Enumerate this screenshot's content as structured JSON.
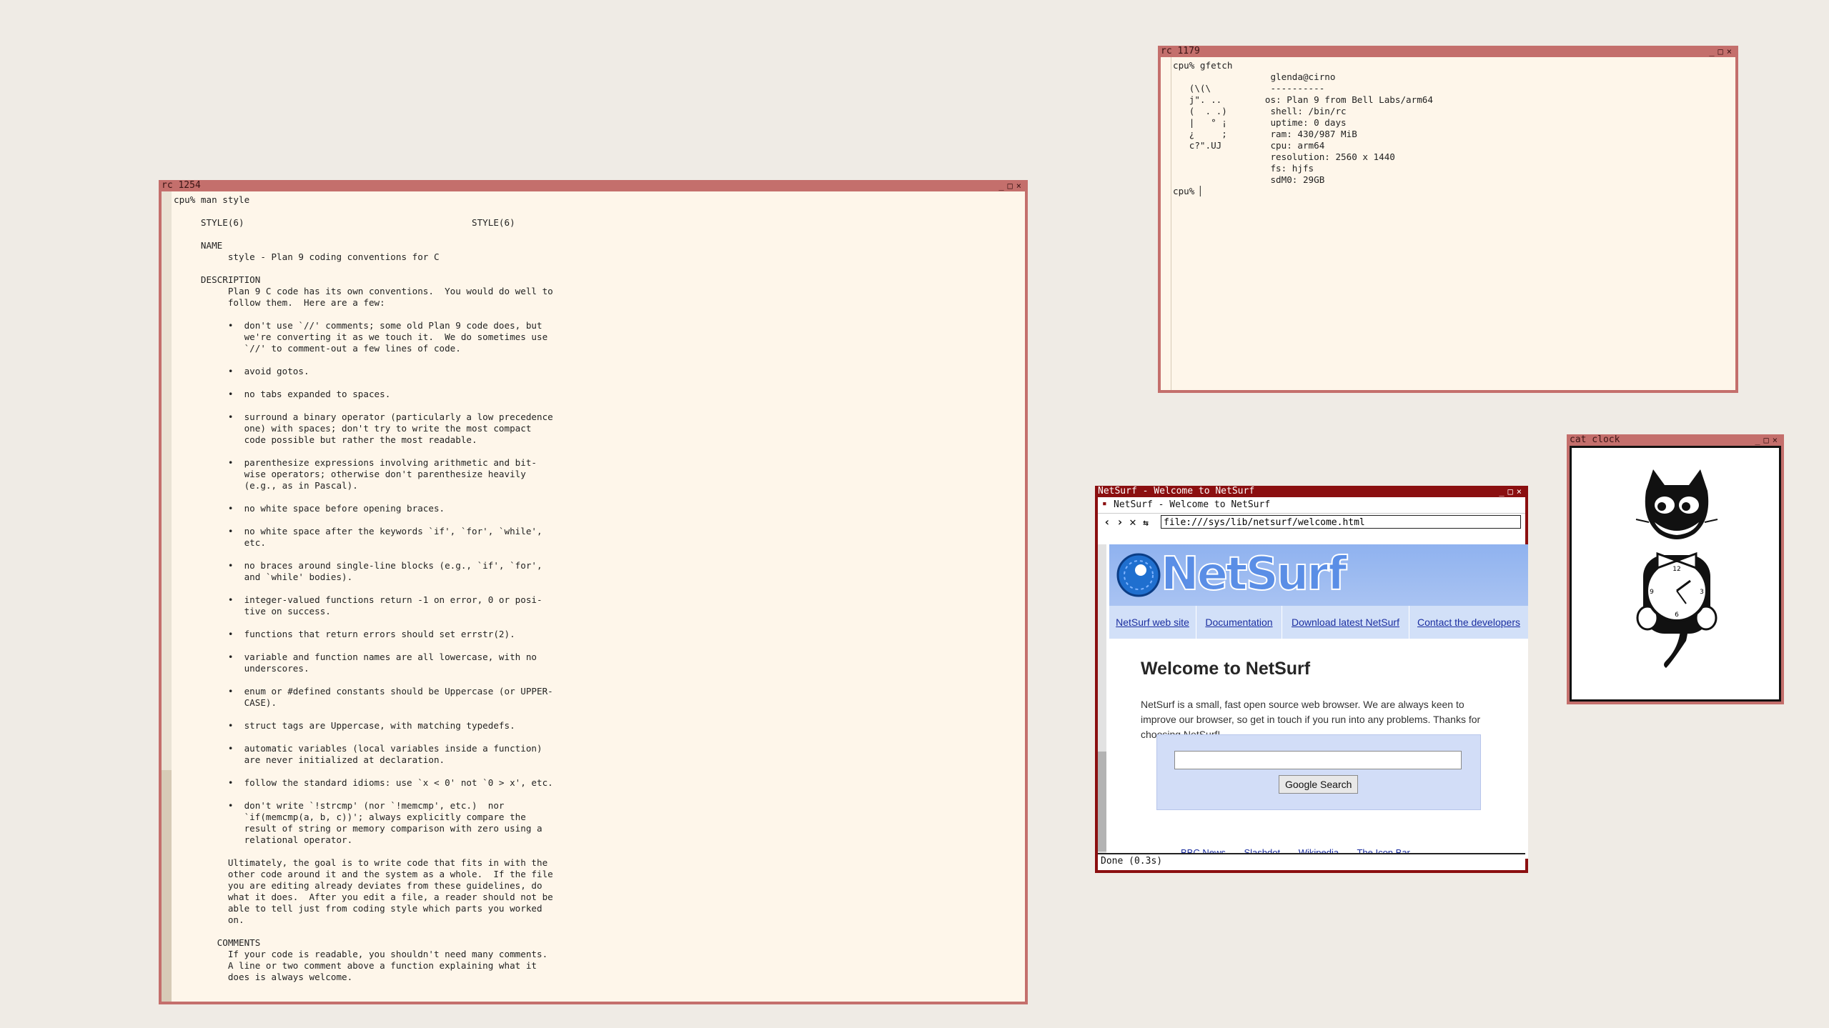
{
  "man_window": {
    "title": "rc 1254",
    "buttons": "_□×",
    "lines": [
      "cpu% man style",
      "",
      "     STYLE(6)                                          STYLE(6)",
      "",
      "     NAME",
      "          style - Plan 9 coding conventions for C",
      "",
      "     DESCRIPTION",
      "          Plan 9 C code has its own conventions.  You would do well to",
      "          follow them.  Here are a few:",
      "",
      "          •  don't use `//' comments; some old Plan 9 code does, but",
      "             we're converting it as we touch it.  We do sometimes use",
      "             `//' to comment-out a few lines of code.",
      "",
      "          •  avoid gotos.",
      "",
      "          •  no tabs expanded to spaces.",
      "",
      "          •  surround a binary operator (particularly a low precedence",
      "             one) with spaces; don't try to write the most compact",
      "             code possible but rather the most readable.",
      "",
      "          •  parenthesize expressions involving arithmetic and bit-",
      "             wise operators; otherwise don't parenthesize heavily",
      "             (e.g., as in Pascal).",
      "",
      "          •  no white space before opening braces.",
      "",
      "          •  no white space after the keywords `if', `for', `while',",
      "             etc.",
      "",
      "          •  no braces around single-line blocks (e.g., `if', `for',",
      "             and `while' bodies).",
      "",
      "          •  integer-valued functions return -1 on error, 0 or posi-",
      "             tive on success.",
      "",
      "          •  functions that return errors should set errstr(2).",
      "",
      "          •  variable and function names are all lowercase, with no",
      "             underscores.",
      "",
      "          •  enum or #defined constants should be Uppercase (or UPPER-",
      "             CASE).",
      "",
      "          •  struct tags are Uppercase, with matching typedefs.",
      "",
      "          •  automatic variables (local variables inside a function)",
      "             are never initialized at declaration.",
      "",
      "          •  follow the standard idioms: use `x < 0' not `0 > x', etc.",
      "",
      "          •  don't write `!strcmp' (nor `!memcmp', etc.)  nor",
      "             `if(memcmp(a, b, c))'; always explicitly compare the",
      "             result of string or memory comparison with zero using a",
      "             relational operator.",
      "",
      "          Ultimately, the goal is to write code that fits in with the",
      "          other code around it and the system as a whole.  If the file",
      "          you are editing already deviates from these guidelines, do",
      "          what it does.  After you edit a file, a reader should not be",
      "          able to tell just from coding style which parts you worked",
      "          on.",
      "",
      "        COMMENTS",
      "          If your code is readable, you shouldn't need many comments.",
      "          A line or two comment above a function explaining what it",
      "          does is always welcome."
    ]
  },
  "gfetch_window": {
    "title": "rc 1179",
    "buttons": "_□×",
    "lines": [
      "cpu% gfetch",
      "                  glenda@cirno",
      "   (\\(\\           ----------",
      "   j\". ..        os: Plan 9 from Bell Labs/arm64",
      "   (  . .)        shell: /bin/rc",
      "   |   ° ¡        uptime: 0 days",
      "   ¿     ;        ram: 430/987 MiB",
      "   c?\".UJ         cpu: arm64",
      "                  resolution: 2560 x 1440",
      "                  fs: hjfs",
      "                  sdM0: 29GB",
      "cpu% "
    ]
  },
  "netsurf_window": {
    "title": "NetSurf - Welcome to NetSurf",
    "buttons": "_□×",
    "tab_title": "NetSurf - Welcome to NetSurf",
    "url": "file:///sys/lib/netsurf/welcome.html",
    "logo_text": "NetSurf",
    "nav": [
      "NetSurf web site",
      "Documentation",
      "Download latest NetSurf",
      "Contact the developers"
    ],
    "heading": "Welcome to NetSurf",
    "paragraph": "NetSurf is a small, fast open source web browser. We are always keen to improve our browser, so get in touch if you run into any problems. Thanks for choosing NetSurf!",
    "search_value": "",
    "search_button": "Google Search",
    "links": [
      "BBC News",
      "Slashdot",
      "Wikipedia",
      "The Icon Bar"
    ],
    "status": "Done (0.3s)"
  },
  "clock_window": {
    "title": "cat clock",
    "buttons": "_□×"
  },
  "colors": {
    "desktop": "#efebe5",
    "border": "#c46f6c",
    "netsurf_title": "#8b0f10",
    "terminal_bg": "#fef6ea",
    "link": "#1b2ea0"
  }
}
